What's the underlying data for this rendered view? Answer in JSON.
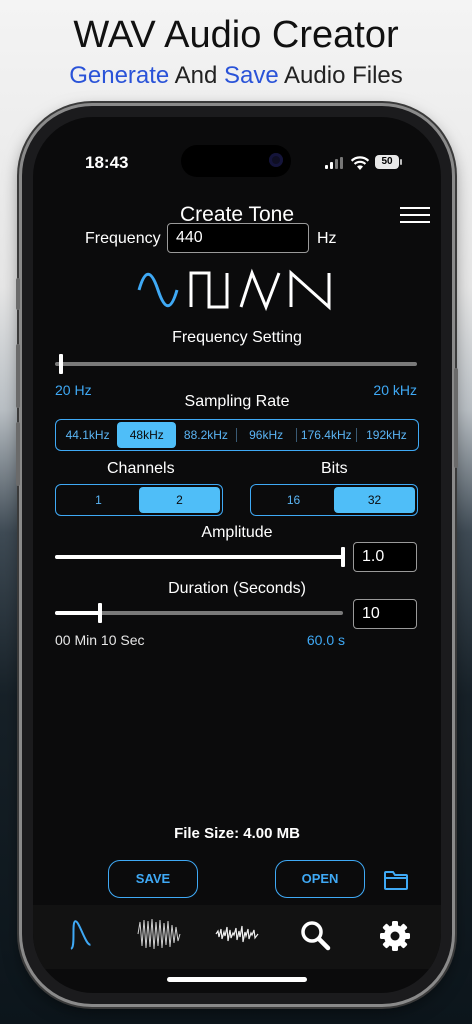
{
  "promo": {
    "title": "WAV Audio Creator",
    "subtitle_word1": "Generate",
    "subtitle_word2": "And",
    "subtitle_word3": "Save",
    "subtitle_word4": "Audio Files"
  },
  "status_bar": {
    "time": "18:43",
    "battery": "50"
  },
  "screen_title": "Create Tone",
  "frequency": {
    "label": "Frequency",
    "value": "440",
    "unit": "Hz"
  },
  "waveforms": [
    "sine-wave-icon",
    "square-wave-icon",
    "triangle-wave-icon",
    "sawtooth-wave-icon"
  ],
  "frequency_setting": {
    "label": "Frequency Setting",
    "min_label": "20 Hz",
    "max_label": "20 kHz",
    "level": 0.0
  },
  "sampling_rate": {
    "label": "Sampling Rate",
    "options": [
      "44.1kHz",
      "48kHz",
      "88.2kHz",
      "96kHz",
      "176.4kHz",
      "192kHz"
    ],
    "selected": "48kHz"
  },
  "channels": {
    "label": "Channels",
    "options": [
      "1",
      "2"
    ],
    "selected": "2"
  },
  "bits": {
    "label": "Bits",
    "options": [
      "16",
      "32"
    ],
    "selected": "32"
  },
  "amplitude": {
    "label": "Amplitude",
    "value": "1.0",
    "level": 1.0
  },
  "duration": {
    "label": "Duration (Seconds)",
    "value": "10",
    "readout": "00 Min 10 Sec",
    "max_label": "60.0 s",
    "level": 0.155
  },
  "file_size": "File Size: 4.00 MB",
  "buttons": {
    "save": "SAVE",
    "open": "OPEN"
  },
  "tabs": [
    "tone-tab-icon",
    "noise-tab-icon",
    "audio-tab-icon",
    "search-icon",
    "settings-icon"
  ],
  "colors": {
    "accent": "#3fa9f5",
    "selected_segment": "#4fbef8",
    "promo_blue": "#2a53d8"
  }
}
